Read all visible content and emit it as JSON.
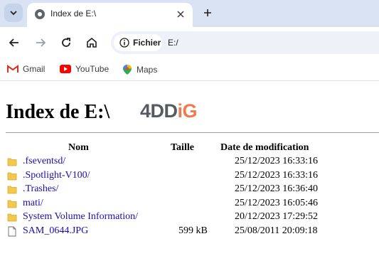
{
  "browser": {
    "tab_title": "Index de E:\\",
    "omnibox_chip": "Fichier",
    "url": "E:/",
    "bookmarks": [
      {
        "label": "Gmail",
        "icon": "gmail-icon"
      },
      {
        "label": "YouTube",
        "icon": "youtube-icon"
      },
      {
        "label": "Maps",
        "icon": "maps-icon"
      }
    ]
  },
  "page": {
    "heading": "Index de E:\\",
    "logo_main": "4DD",
    "logo_accent": "iG",
    "columns": {
      "name": "Nom",
      "size": "Taille",
      "modified": "Date de modification"
    },
    "entries": [
      {
        "name": ".fseventsd/",
        "size": "",
        "modified": "25/12/2023 16:33:16",
        "type": "folder"
      },
      {
        "name": ".Spotlight-V100/",
        "size": "",
        "modified": "25/12/2023 16:33:16",
        "type": "folder"
      },
      {
        "name": ".Trashes/",
        "size": "",
        "modified": "25/12/2023 16:36:40",
        "type": "folder"
      },
      {
        "name": "mati/",
        "size": "",
        "modified": "25/12/2023 16:05:46",
        "type": "folder"
      },
      {
        "name": "System Volume Information/",
        "size": "",
        "modified": "20/12/2023 17:29:52",
        "type": "folder"
      },
      {
        "name": "SAM_0644.JPG",
        "size": "599 kB",
        "modified": "25/08/2011 20:09:18",
        "type": "file"
      }
    ]
  },
  "colors": {
    "tabstrip": "#dae3f3",
    "link": "#1a0dab",
    "folder": "#f2c94c",
    "logo_accent": "#ef7a52"
  }
}
